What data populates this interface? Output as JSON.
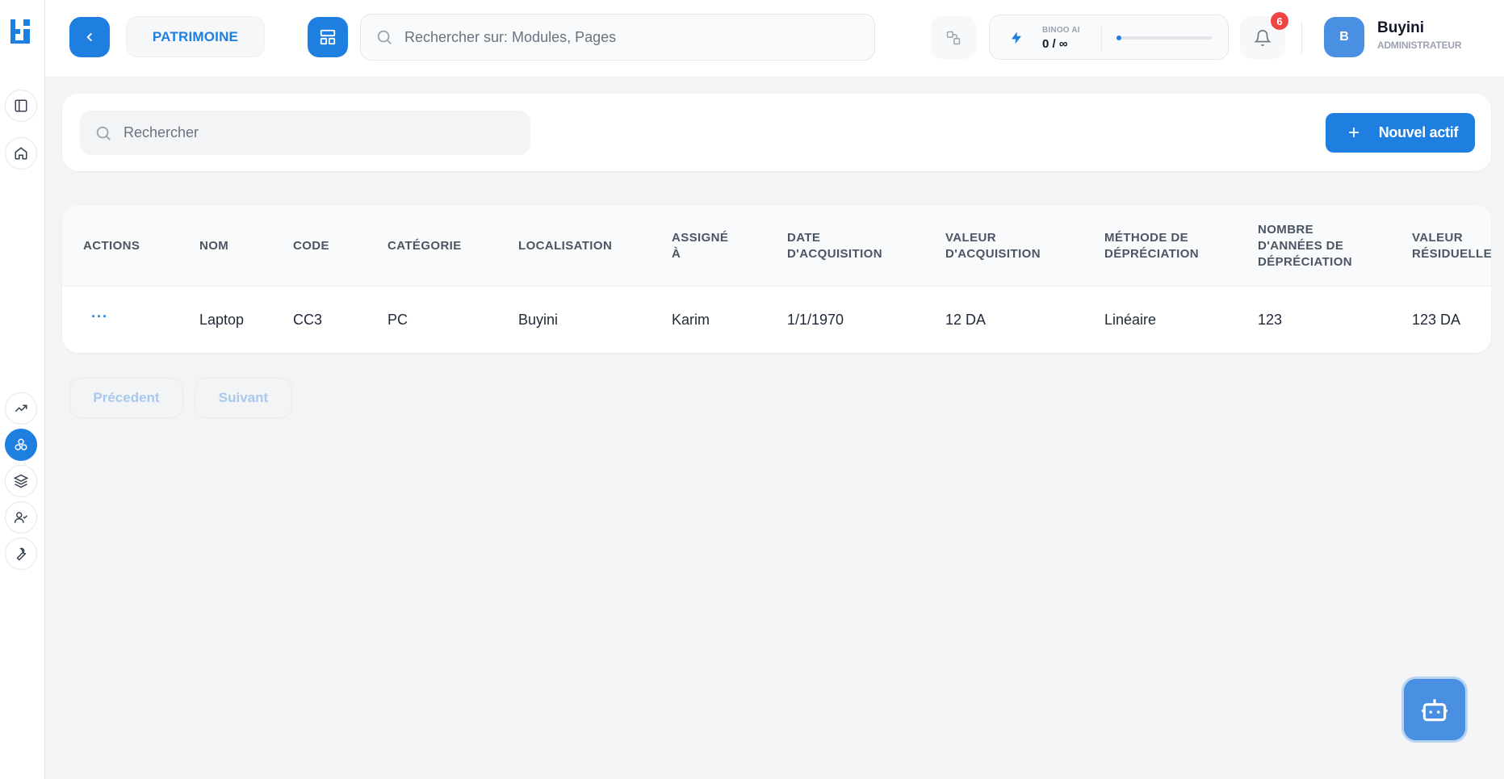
{
  "header": {
    "module_label": "PATRIMOINE",
    "search_placeholder": "Rechercher sur: Modules, Pages",
    "ai": {
      "label": "BINOO AI",
      "usage": "0 / ∞",
      "usage_fraction": 0.04
    },
    "notifications_count": "6",
    "user": {
      "initial": "B",
      "name": "Buyini",
      "role": "ADMINISTRATEUR"
    }
  },
  "sidebar": {
    "items": [
      {
        "icon": "sidebar-toggle-icon"
      },
      {
        "icon": "home-icon"
      },
      {
        "icon": "trending-up-icon"
      },
      {
        "icon": "assets-icon",
        "active": true
      },
      {
        "icon": "layers-icon"
      },
      {
        "icon": "user-check-icon"
      },
      {
        "icon": "wrench-icon"
      }
    ]
  },
  "toolbar": {
    "search_placeholder": "Rechercher",
    "new_button_label": "Nouvel actif"
  },
  "table": {
    "columns": [
      [
        "ACTIONS"
      ],
      [
        "NOM"
      ],
      [
        "CODE"
      ],
      [
        "CATÉGORIE"
      ],
      [
        "LOCALISATION"
      ],
      [
        "ASSIGNÉ",
        "À"
      ],
      [
        "DATE",
        "D'ACQUISITION"
      ],
      [
        "VALEUR",
        "D'ACQUISITION"
      ],
      [
        "MÉTHODE DE",
        "DÉPRÉCIATION"
      ],
      [
        "NOMBRE",
        "D'ANNÉES DE",
        "DÉPRÉCIATION"
      ],
      [
        "VALEUR",
        "RÉSIDUELLE"
      ]
    ],
    "rows": [
      {
        "actions": "···",
        "nom": "Laptop",
        "code": "CC3",
        "categorie": "PC",
        "localisation": "Buyini",
        "assigne": "Karim",
        "date_acquisition": "1/1/1970",
        "valeur_acquisition": "12 DA",
        "methode": "Linéaire",
        "annees": "123",
        "valeur_residuelle": "123 DA"
      }
    ]
  },
  "pagination": {
    "prev_label": "Précedent",
    "next_label": "Suivant"
  },
  "colors": {
    "accent": "#1e7fe0",
    "badge": "#ef4444",
    "background": "#f3f4f6"
  }
}
